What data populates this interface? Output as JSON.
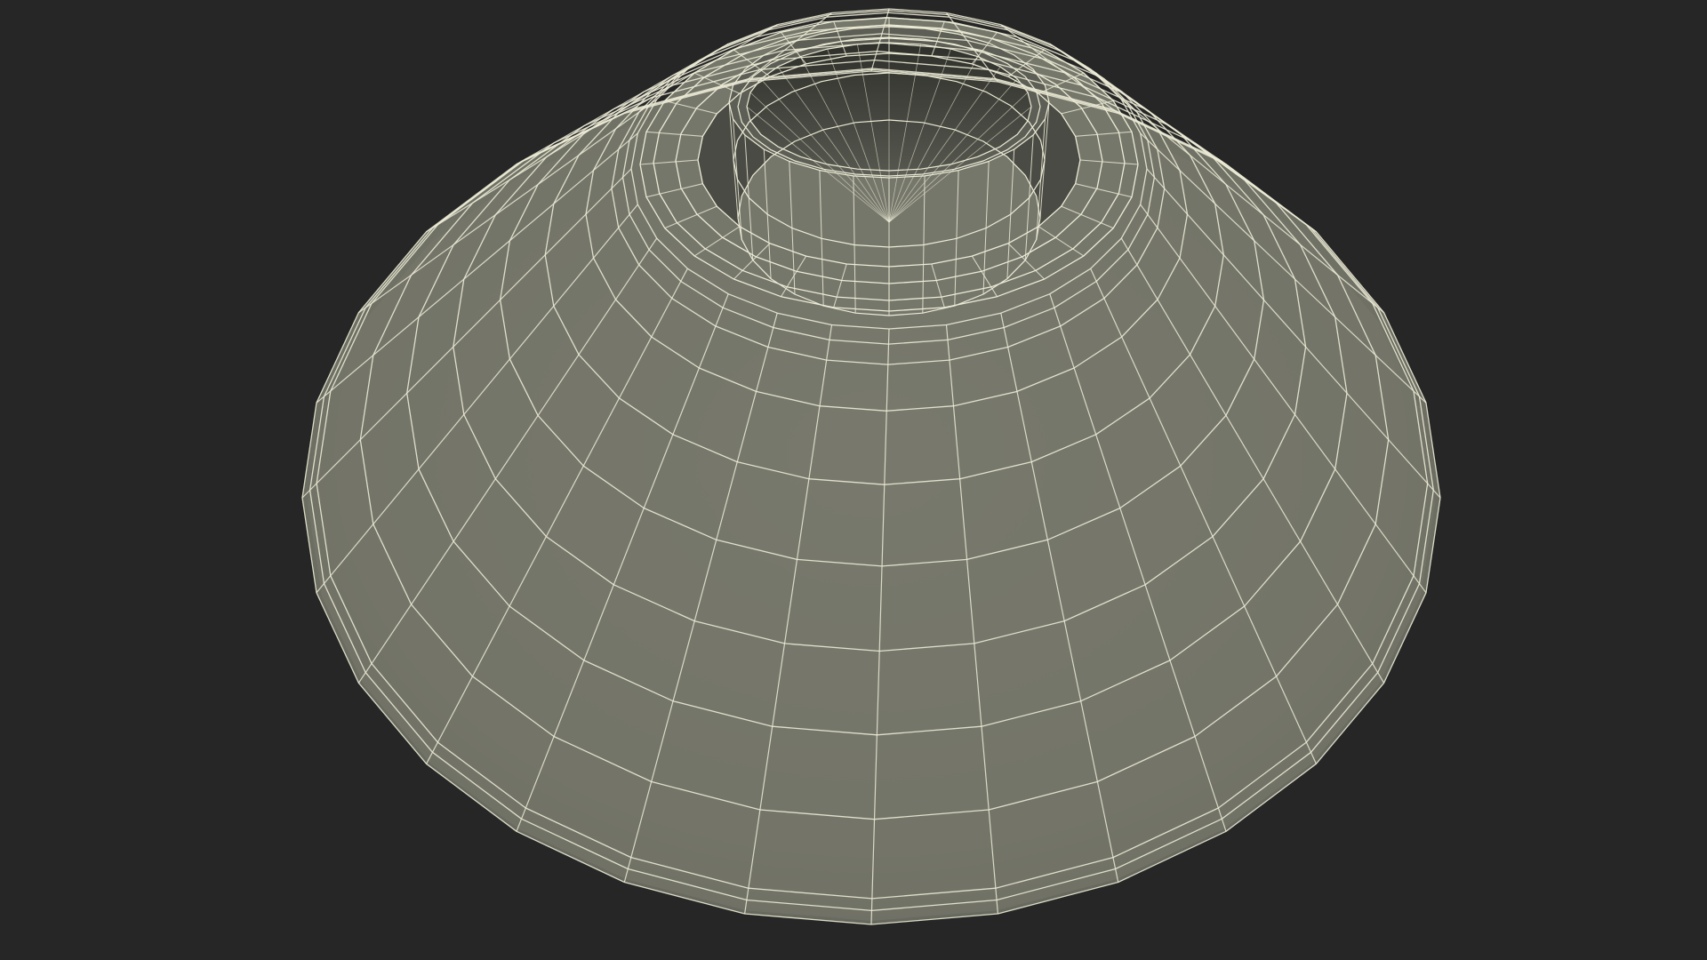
{
  "scene": {
    "subject": "wireframe-cone-mesh",
    "colors": {
      "background": "#262626",
      "surface": "#76776b",
      "surface_dark": "#5d5e55",
      "interior": "#4a4b44",
      "wire": "#ecebd6"
    }
  }
}
